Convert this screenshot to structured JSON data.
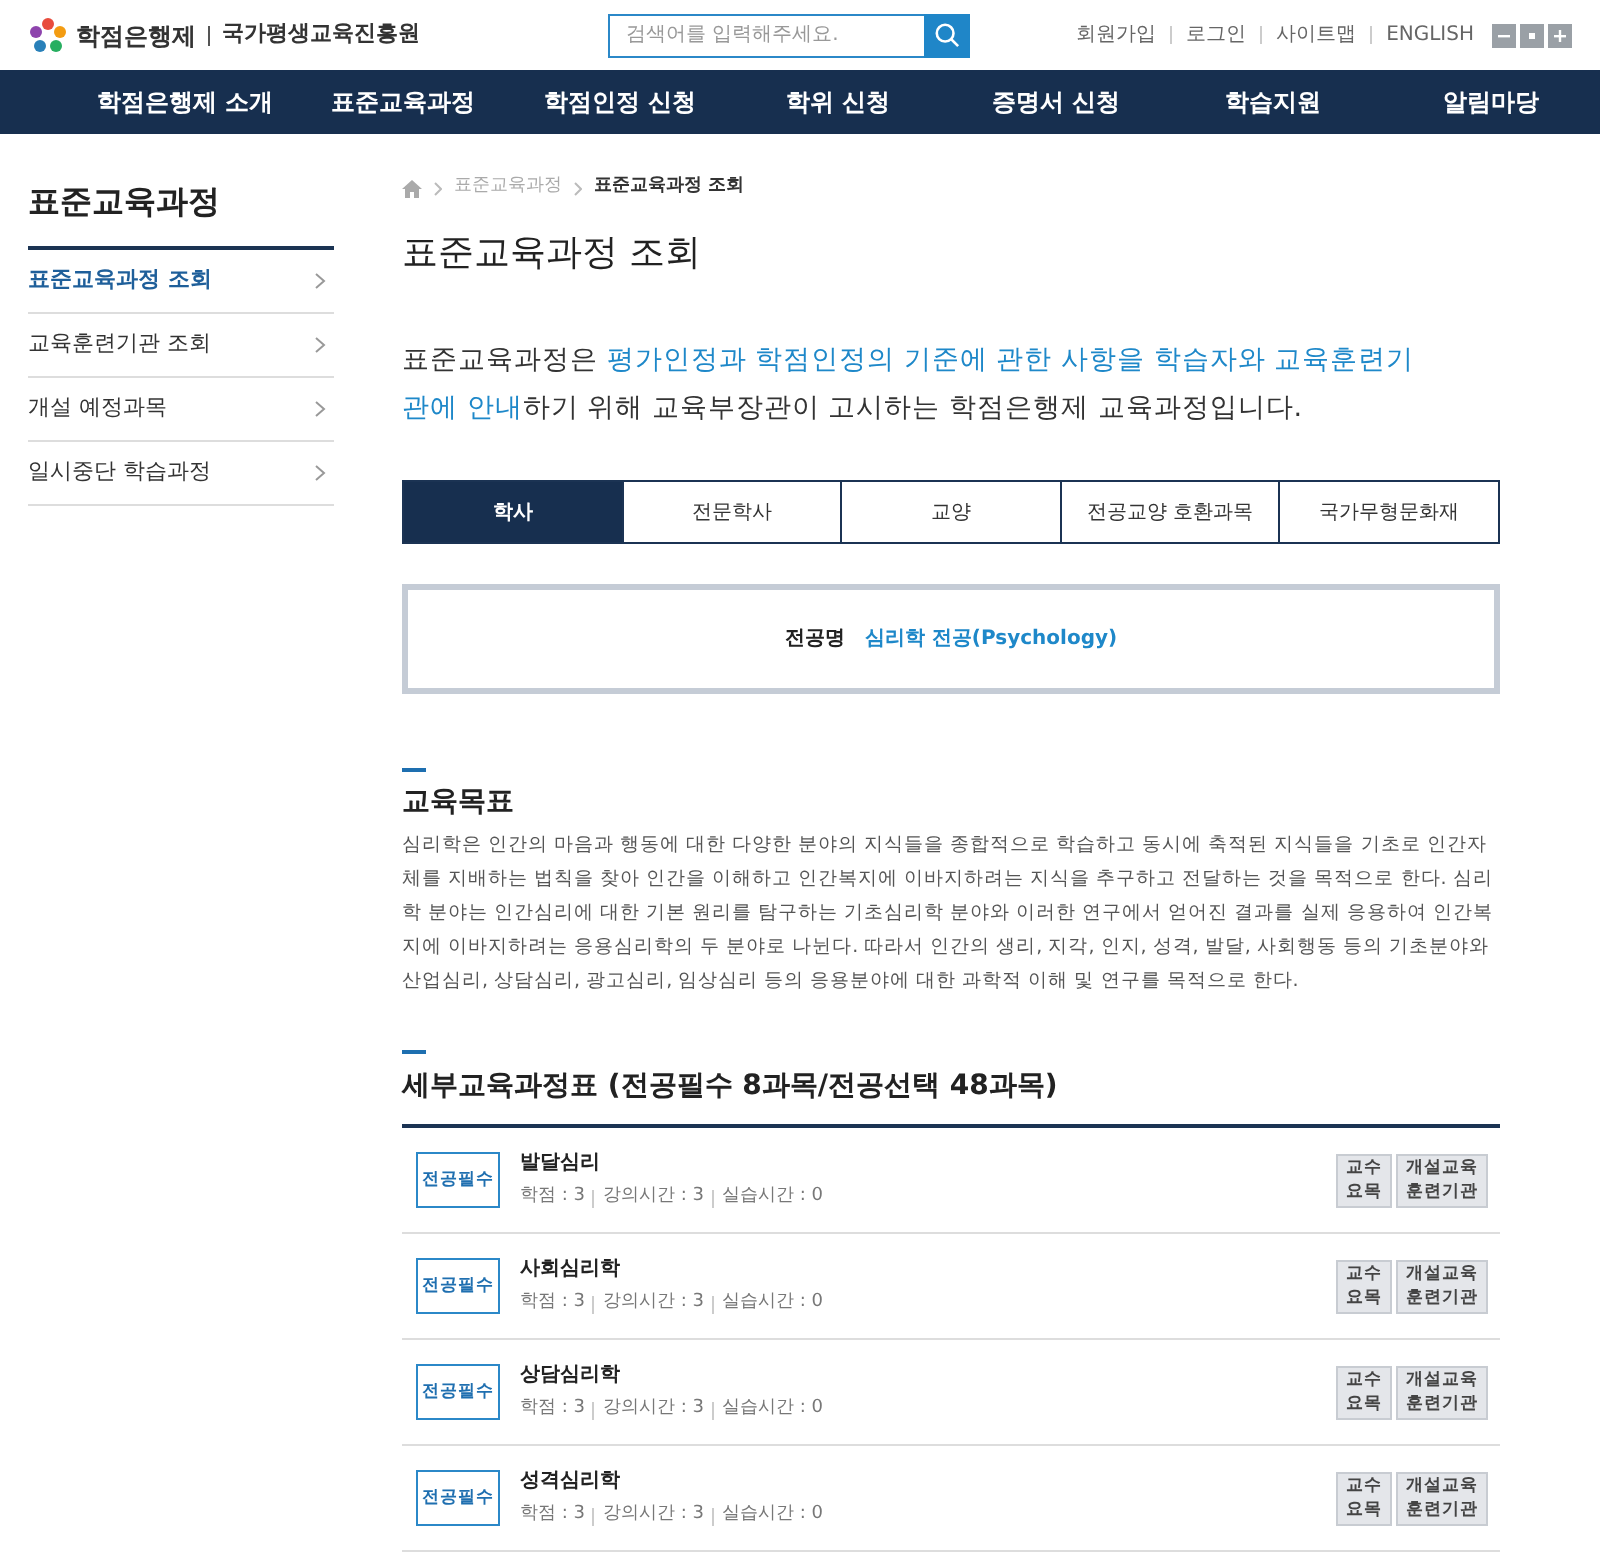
{
  "header": {
    "logo_text": "학점은행제",
    "org_name": "국가평생교육진흥원",
    "search": {
      "placeholder": "검색어를 입력해주세요."
    },
    "util_links": [
      "회원가입",
      "로그인",
      "사이트맵",
      "ENGLISH"
    ],
    "font_controls": [
      {
        "kind": "minus"
      },
      {
        "kind": "reset"
      },
      {
        "kind": "plus"
      }
    ]
  },
  "nav": {
    "items": [
      "학점은행제 소개",
      "표준교육과정",
      "학점인정 신청",
      "학위 신청",
      "증명서 신청",
      "학습지원",
      "알림마당"
    ]
  },
  "sidebar": {
    "title": "표준교육과정",
    "items": [
      {
        "label": "표준교육과정 조회",
        "selected": true
      },
      {
        "label": "교육훈련기관 조회",
        "selected": false
      },
      {
        "label": "개설 예정과목",
        "selected": false
      },
      {
        "label": "일시중단 학습과정",
        "selected": false
      }
    ]
  },
  "breadcrumb": [
    "표준교육과정",
    "표준교육과정 조회"
  ],
  "page_title": "표준교육과정 조회",
  "intro": [
    {
      "text": "표준교육과정은 ",
      "highlight": false
    },
    {
      "text": "평가인정과 학점인정의 기준에 관한 사항을 학습자와 교육훈련기관에 안내",
      "highlight": true
    },
    {
      "text": "하기 위해 교육부장관이 고시하는 학점은행제 교육과정입니다.",
      "highlight": false
    }
  ],
  "tabs": [
    {
      "label": "학사",
      "selected": true
    },
    {
      "label": "전문학사",
      "selected": false
    },
    {
      "label": "교양",
      "selected": false
    },
    {
      "label": "전공교양 호환과목",
      "selected": false
    },
    {
      "label": "국가무형문화재",
      "selected": false
    }
  ],
  "major": {
    "label": "전공명",
    "value": "심리학 전공(Psychology)"
  },
  "goal": {
    "title": "교육목표",
    "text": "심리학은 인간의 마음과 행동에 대한 다양한 분야의 지식들을 종합적으로 학습하고 동시에 축적된 지식들을 기초로 인간자체를 지배하는 법칙을 찾아 인간을 이해하고 인간복지에 이바지하려는 지식을 추구하고 전달하는 것을 목적으로 한다. 심리학 분야는 인간심리에 대한 기본 원리를 탐구하는 기초심리학 분야와 이러한 연구에서 얻어진 결과를 실제 응용하여 인간복지에 이바지하려는 응용심리학의 두 분야로 나뉜다. 따라서 인간의 생리, 지각, 인지, 성격, 발달, 사회행동 등의 기초분야와 산업심리, 상담심리, 광고심리, 임상심리 등의 응용분야에 대한 과학적 이해 및 연구를 목적으로 한다."
  },
  "curriculum": {
    "title": "세부교육과정표 (전공필수 8과목/전공선택 48과목)",
    "courses": [
      {
        "type": "전공필수",
        "name": "발달심리",
        "stats": [
          "학점 : 3",
          "강의시간 : 3",
          "실습시간 : 0"
        ],
        "buttons": [
          "교수\n요목",
          "개설교육\n훈련기관"
        ]
      },
      {
        "type": "전공필수",
        "name": "사회심리학",
        "stats": [
          "학점 : 3",
          "강의시간 : 3",
          "실습시간 : 0"
        ],
        "buttons": [
          "교수\n요목",
          "개설교육\n훈련기관"
        ]
      },
      {
        "type": "전공필수",
        "name": "상담심리학",
        "stats": [
          "학점 : 3",
          "강의시간 : 3",
          "실습시간 : 0"
        ],
        "buttons": [
          "교수\n요목",
          "개설교육\n훈련기관"
        ]
      },
      {
        "type": "전공필수",
        "name": "성격심리학",
        "stats": [
          "학점 : 3",
          "강의시간 : 3",
          "실습시간 : 0"
        ],
        "buttons": [
          "교수\n요목",
          "개설교육\n훈련기관"
        ]
      }
    ]
  }
}
